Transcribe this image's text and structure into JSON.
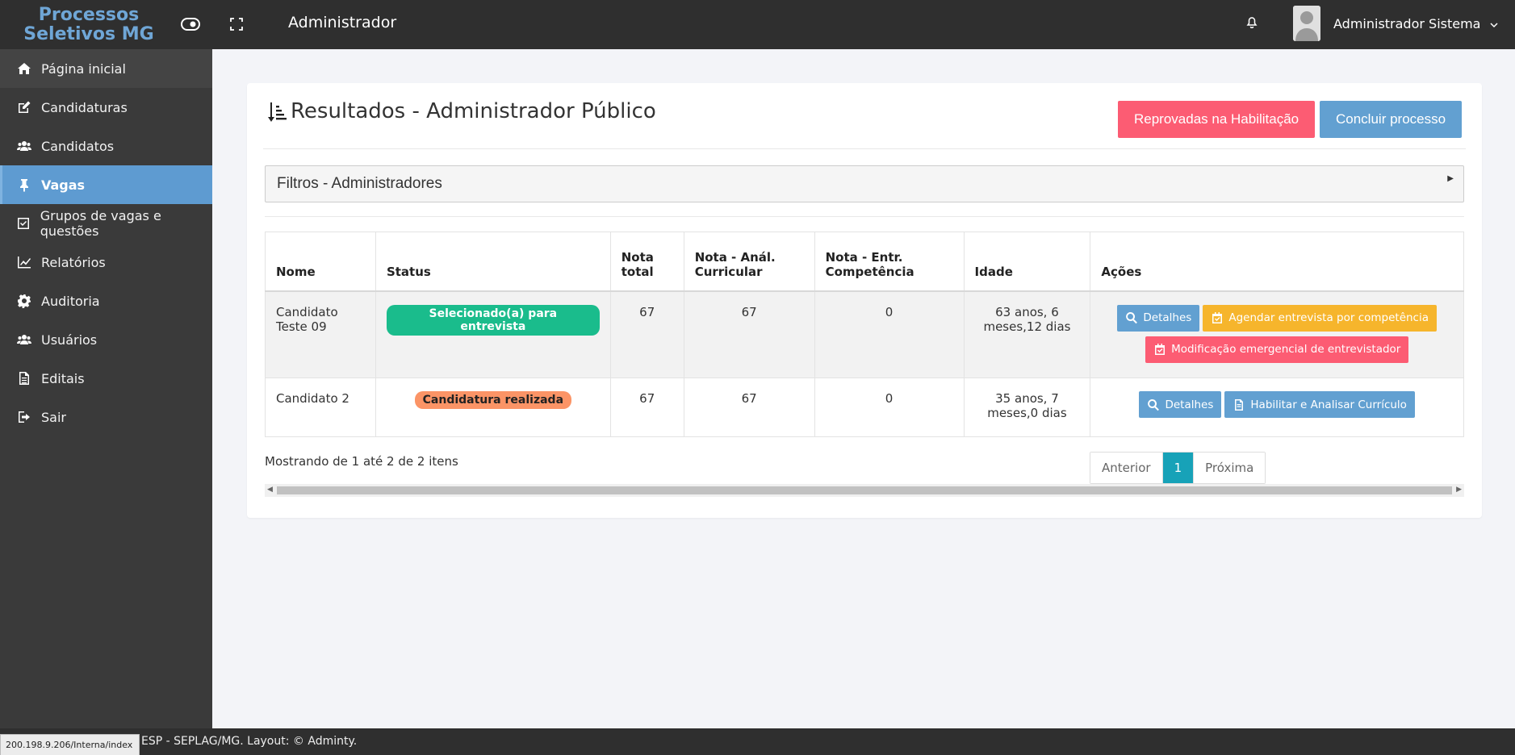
{
  "topbar": {
    "logo_line1": "Processos",
    "logo_line2": "Seletivos MG",
    "section_title": "Administrador",
    "user_name": "Administrador Sistema"
  },
  "sidebar": {
    "items": [
      {
        "label": "Página inicial",
        "icon": "home-icon"
      },
      {
        "label": "Candidaturas",
        "icon": "edit-icon"
      },
      {
        "label": "Candidatos",
        "icon": "users-icon"
      },
      {
        "label": "Vagas",
        "icon": "pin-icon"
      },
      {
        "label": "Grupos de vagas e questões",
        "icon": "checkbox-icon"
      },
      {
        "label": "Relatórios",
        "icon": "chart-icon"
      },
      {
        "label": "Auditoria",
        "icon": "gear-icon"
      },
      {
        "label": "Usuários",
        "icon": "users-icon"
      },
      {
        "label": "Editais",
        "icon": "document-icon"
      },
      {
        "label": "Sair",
        "icon": "sign-out-icon"
      }
    ]
  },
  "card": {
    "title": "Resultados - Administrador Público",
    "btn_reprovadas": "Reprovadas na Habilitação",
    "btn_concluir": "Concluir processo",
    "filter_label": "Filtros - Administradores"
  },
  "table": {
    "headers": {
      "nome": "Nome",
      "status": "Status",
      "nota_total_1": "Nota",
      "nota_total_2": "total",
      "nota_anal_1": "Nota - Anál.",
      "nota_anal_2": "Curricular",
      "nota_entr_1": "Nota - Entr.",
      "nota_entr_2": "Competência",
      "idade": "Idade",
      "acoes": "Ações"
    },
    "rows": [
      {
        "nome_1": "Candidato",
        "nome_2": "Teste 09",
        "status": "Selecionado(a) para entrevista",
        "nota_total": "67",
        "nota_anal": "67",
        "nota_entr": "0",
        "idade_1": "63 anos, 6",
        "idade_2": "meses,12 dias",
        "btn_detalhes": "Detalhes",
        "btn_agendar": "Agendar entrevista por competência",
        "btn_modificacao": "Modificação emergencial de entrevistador"
      },
      {
        "nome_1": "Candidato 2",
        "status": "Candidatura realizada",
        "nota_total": "67",
        "nota_anal": "67",
        "nota_entr": "0",
        "idade_1": "35 anos, 7",
        "idade_2": "meses,0 dias",
        "btn_detalhes": "Detalhes",
        "btn_habilitar": "Habilitar e Analisar Currículo"
      }
    ]
  },
  "pagination": {
    "showing": "Mostrando de 1 até 2 de 2 itens",
    "prev": "Anterior",
    "current": "1",
    "next": "Próxima"
  },
  "footer": {
    "text": "ESP - SEPLAG/MG. Layout: © Adminty.",
    "status_url": "200.198.9.206/Interna/index"
  },
  "colors": {
    "accent_blue": "#62a0d1",
    "danger_red": "#fc5c73",
    "warning_yellow": "#f6b52c",
    "success_green": "#1abc8c",
    "badge_orange": "#fb9466",
    "pager_active": "#17a2b8"
  }
}
